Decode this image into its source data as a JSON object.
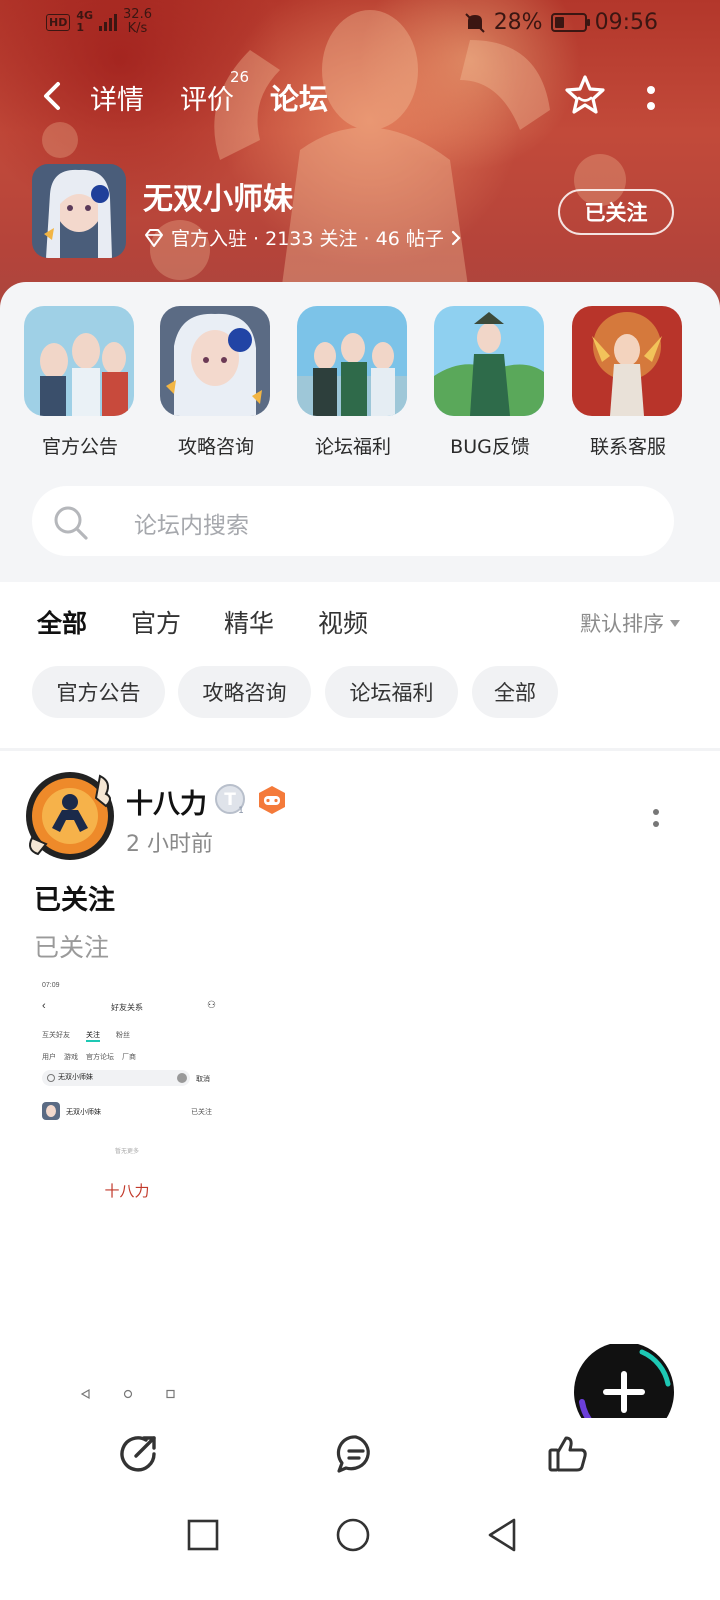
{
  "status_bar": {
    "hd": "HD",
    "network_top": "4G",
    "network_bottom": "1",
    "speed_value": "32.6",
    "speed_unit": "K/s",
    "battery": "28%",
    "time": "09:56"
  },
  "nav": {
    "tabs": [
      {
        "label": "详情"
      },
      {
        "label": "评价"
      },
      {
        "label": "论坛"
      }
    ],
    "reviews_badge": "26",
    "active_tab": "论坛"
  },
  "game": {
    "title": "无双小师妹",
    "meta": "官方入驻 · 2133 关注 · 46 帖子",
    "follow_label": "已关注"
  },
  "quick_entries": [
    {
      "label": "官方公告"
    },
    {
      "label": "攻略咨询"
    },
    {
      "label": "论坛福利"
    },
    {
      "label": "BUG反馈"
    },
    {
      "label": "联系客服"
    }
  ],
  "search": {
    "placeholder": "论坛内搜索"
  },
  "filter_tabs": [
    {
      "label": "全部"
    },
    {
      "label": "官方"
    },
    {
      "label": "精华"
    },
    {
      "label": "视频"
    }
  ],
  "sort_label": "默认排序",
  "chips": [
    {
      "label": "官方公告"
    },
    {
      "label": "攻略咨询"
    },
    {
      "label": "论坛福利"
    },
    {
      "label": "全部"
    }
  ],
  "post": {
    "author": "十八力",
    "time": "2 小时前",
    "title": "已关注",
    "body": "已关注",
    "image": {
      "status_time": "07:09",
      "title": "好友关系",
      "tabs": [
        "互关好友",
        "关注",
        "粉丝"
      ],
      "subtabs": [
        "用户",
        "游戏",
        "官方论坛",
        "厂商"
      ],
      "search_text": "无双小师妹",
      "cancel": "取消",
      "result_name": "无双小师妹",
      "result_status": "已关注",
      "no_more": "暂无更多",
      "signature": "十八力"
    }
  },
  "colors": {
    "accent": "#1ec8b4",
    "banner": "#b84236",
    "page_bg": "#f4f5f7"
  }
}
